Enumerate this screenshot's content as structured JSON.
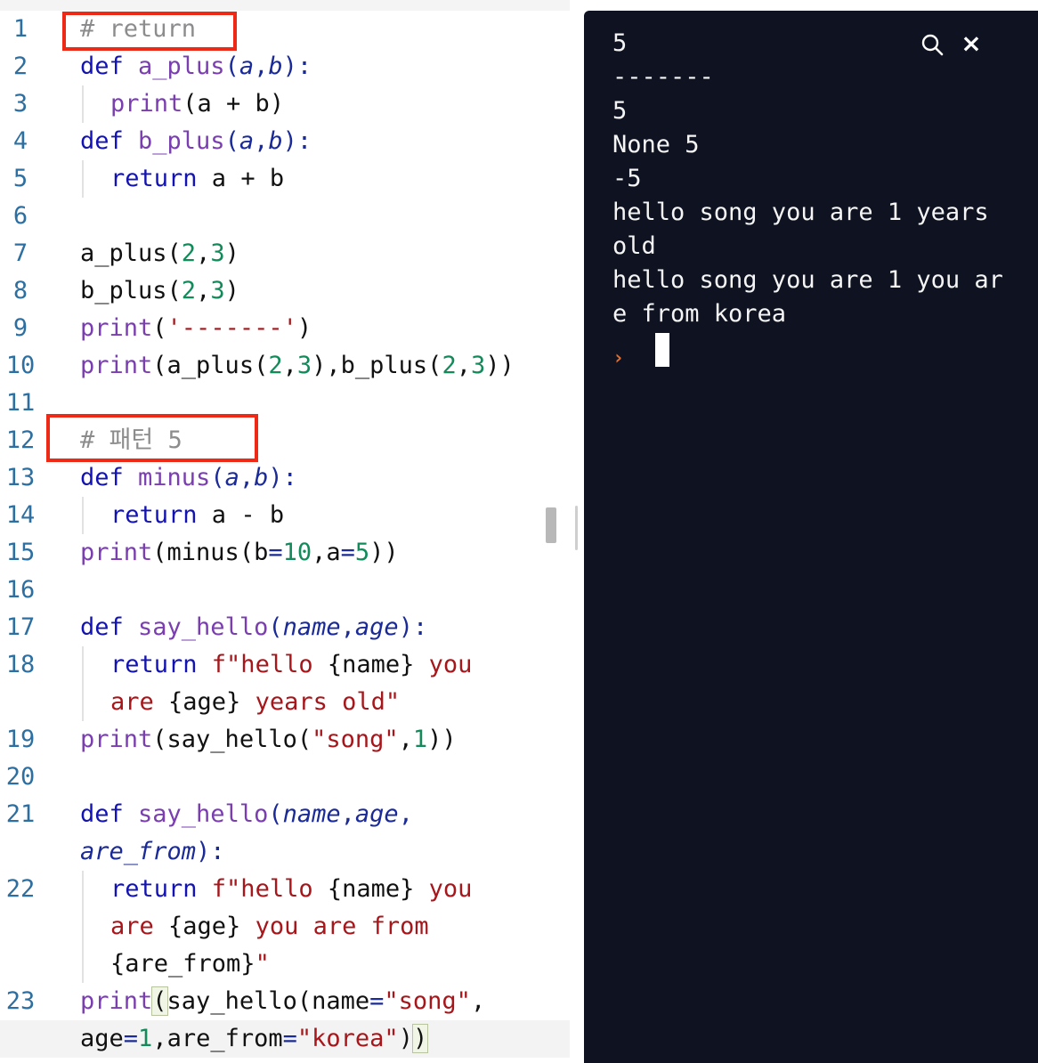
{
  "editor": {
    "lines": [
      {
        "n": "1",
        "tokens": [
          [
            "cm",
            "# return"
          ]
        ]
      },
      {
        "n": "2",
        "tokens": [
          [
            "kw",
            "def "
          ],
          [
            "fn",
            "a_plus"
          ],
          [
            "op",
            "("
          ],
          [
            "pr",
            "a"
          ],
          [
            "op",
            ","
          ],
          [
            "pr",
            "b"
          ],
          [
            "op",
            "):"
          ]
        ]
      },
      {
        "n": "3",
        "indent": true,
        "tokens": [
          [
            "fn",
            "print"
          ],
          [
            "",
            "(a + b)"
          ]
        ]
      },
      {
        "n": "4",
        "tokens": [
          [
            "kw",
            "def "
          ],
          [
            "fn",
            "b_plus"
          ],
          [
            "op",
            "("
          ],
          [
            "pr",
            "a"
          ],
          [
            "op",
            ","
          ],
          [
            "pr",
            "b"
          ],
          [
            "op",
            "):"
          ]
        ]
      },
      {
        "n": "5",
        "indent": true,
        "tokens": [
          [
            "kw",
            "return"
          ],
          [
            "",
            " a + b"
          ]
        ]
      },
      {
        "n": "6",
        "tokens": []
      },
      {
        "n": "7",
        "tokens": [
          [
            "",
            "a_plus("
          ],
          [
            "num",
            "2"
          ],
          [
            "",
            ","
          ],
          [
            "num",
            "3"
          ],
          [
            "",
            ")"
          ]
        ]
      },
      {
        "n": "8",
        "tokens": [
          [
            "",
            "b_plus("
          ],
          [
            "num",
            "2"
          ],
          [
            "",
            ","
          ],
          [
            "num",
            "3"
          ],
          [
            "",
            ")"
          ]
        ]
      },
      {
        "n": "9",
        "tokens": [
          [
            "fn",
            "print"
          ],
          [
            "",
            "("
          ],
          [
            "str",
            "'-------'"
          ],
          [
            "",
            ")"
          ]
        ]
      },
      {
        "n": "10",
        "tokens": [
          [
            "fn",
            "print"
          ],
          [
            "",
            "(a_plus("
          ],
          [
            "num",
            "2"
          ],
          [
            "",
            ","
          ],
          [
            "num",
            "3"
          ],
          [
            "",
            "),b_plus("
          ],
          [
            "num",
            "2"
          ],
          [
            "",
            ","
          ],
          [
            "num",
            "3"
          ],
          [
            "",
            "))"
          ]
        ]
      },
      {
        "n": "11",
        "tokens": []
      },
      {
        "n": "12",
        "tokens": [
          [
            "cm",
            "# 패턴 5"
          ]
        ]
      },
      {
        "n": "13",
        "tokens": [
          [
            "kw",
            "def "
          ],
          [
            "fn",
            "minus"
          ],
          [
            "op",
            "("
          ],
          [
            "pr",
            "a"
          ],
          [
            "op",
            ","
          ],
          [
            "pr",
            "b"
          ],
          [
            "op",
            "):"
          ]
        ]
      },
      {
        "n": "14",
        "indent": true,
        "tokens": [
          [
            "kw",
            "return"
          ],
          [
            "",
            " a - b"
          ]
        ]
      },
      {
        "n": "15",
        "tokens": [
          [
            "fn",
            "print"
          ],
          [
            "",
            "(minus(b"
          ],
          [
            "op",
            "="
          ],
          [
            "num",
            "10"
          ],
          [
            "",
            ",a"
          ],
          [
            "op",
            "="
          ],
          [
            "num",
            "5"
          ],
          [
            "",
            "))"
          ]
        ]
      },
      {
        "n": "16",
        "tokens": []
      },
      {
        "n": "17",
        "tokens": [
          [
            "kw",
            "def "
          ],
          [
            "fn",
            "say_hello"
          ],
          [
            "op",
            "("
          ],
          [
            "pr",
            "name"
          ],
          [
            "op",
            ","
          ],
          [
            "pr",
            "age"
          ],
          [
            "op",
            "):"
          ]
        ]
      },
      {
        "n": "18",
        "indent": true,
        "tokens": [
          [
            "kw",
            "return "
          ],
          [
            "str",
            "f\"hello "
          ],
          [
            "",
            "{name}"
          ],
          [
            "str",
            " you"
          ]
        ]
      },
      {
        "n": "",
        "indent": true,
        "tokens": [
          [
            "str",
            "are "
          ],
          [
            "",
            "{age}"
          ],
          [
            "str",
            " years old\""
          ]
        ]
      },
      {
        "n": "19",
        "tokens": [
          [
            "fn",
            "print"
          ],
          [
            "",
            "(say_hello("
          ],
          [
            "str",
            "\"song\""
          ],
          [
            "",
            ","
          ],
          [
            "num",
            "1"
          ],
          [
            "",
            "))"
          ]
        ]
      },
      {
        "n": "20",
        "tokens": []
      },
      {
        "n": "21",
        "tokens": [
          [
            "kw",
            "def "
          ],
          [
            "fn",
            "say_hello"
          ],
          [
            "op",
            "("
          ],
          [
            "pr",
            "name"
          ],
          [
            "op",
            ","
          ],
          [
            "pr",
            "age"
          ],
          [
            "op",
            ","
          ]
        ]
      },
      {
        "n": "",
        "tokens": [
          [
            "pr",
            "are_from"
          ],
          [
            "op",
            "):"
          ]
        ]
      },
      {
        "n": "22",
        "indent": true,
        "tokens": [
          [
            "kw",
            "return "
          ],
          [
            "str",
            "f\"hello "
          ],
          [
            "",
            "{name}"
          ],
          [
            "str",
            " you"
          ]
        ]
      },
      {
        "n": "",
        "indent": true,
        "tokens": [
          [
            "str",
            "are "
          ],
          [
            "",
            "{age}"
          ],
          [
            "str",
            " you are from"
          ]
        ]
      },
      {
        "n": "",
        "indent": true,
        "tokens": [
          [
            "",
            "{are_from}"
          ],
          [
            "str",
            "\""
          ]
        ]
      },
      {
        "n": "23",
        "tokens": [
          [
            "fn",
            "print"
          ],
          [
            "hl",
            "("
          ],
          [
            "",
            "say_hello(name"
          ],
          [
            "op",
            "="
          ],
          [
            "str",
            "\"song\""
          ],
          [
            "",
            ","
          ]
        ]
      },
      {
        "n": "",
        "tokens": [
          [
            "",
            "age"
          ],
          [
            "op",
            "="
          ],
          [
            "num",
            "1"
          ],
          [
            "",
            ",are_from"
          ],
          [
            "op",
            "="
          ],
          [
            "str",
            "\"korea\""
          ],
          [
            "",
            ")"
          ],
          [
            "hl",
            ")"
          ]
        ]
      }
    ]
  },
  "console": {
    "output_lines": [
      "5",
      "-------",
      "5",
      "None 5",
      "-5",
      "hello song you are 1 years",
      "old",
      "hello song you are 1 you ar",
      "e from korea"
    ],
    "prompt_symbol": "›",
    "close_symbol": "×",
    "icons": [
      "search-icon",
      "close-icon"
    ]
  },
  "colors": {
    "highlight_box": "#ee2a16",
    "console_bg": "#0e1221",
    "prompt": "#f06a1e"
  }
}
